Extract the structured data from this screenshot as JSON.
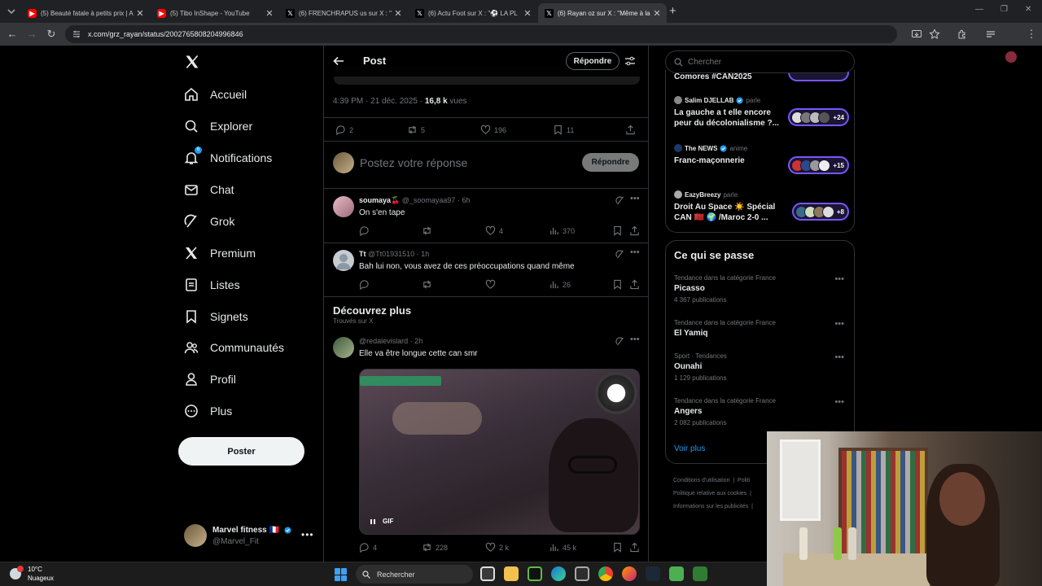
{
  "browser": {
    "tabs": [
      {
        "title": "(5) Beauté fatale à petits prix | A",
        "icon": "youtube-icon",
        "active": false
      },
      {
        "title": "(5) Tibo InShape - YouTube",
        "icon": "youtube-icon",
        "active": false
      },
      {
        "title": "(6) FRENCHRAPUS us sur X : \"",
        "icon": "x-icon",
        "active": false
      },
      {
        "title": "(6) Actu Foot sur X : \"⚽ LA PL",
        "icon": "x-icon",
        "active": false
      },
      {
        "title": "(6) Rayan oz sur X : \"Même à la",
        "icon": "x-icon",
        "active": true
      }
    ],
    "new_tab": "+",
    "url": "x.com/grz_rayan/status/2002765808204996846"
  },
  "nav": {
    "items": [
      {
        "label": "Accueil",
        "icon": "home-icon"
      },
      {
        "label": "Explorer",
        "icon": "search-icon"
      },
      {
        "label": "Notifications",
        "icon": "bell-icon",
        "badge": "6"
      },
      {
        "label": "Chat",
        "icon": "mail-icon"
      },
      {
        "label": "Grok",
        "icon": "grok-icon"
      },
      {
        "label": "Premium",
        "icon": "x-logo-icon"
      },
      {
        "label": "Listes",
        "icon": "list-icon"
      },
      {
        "label": "Signets",
        "icon": "bookmark-icon"
      },
      {
        "label": "Communautés",
        "icon": "communities-icon"
      },
      {
        "label": "Profil",
        "icon": "person-icon"
      },
      {
        "label": "Plus",
        "icon": "more-circle-icon"
      }
    ],
    "post_button": "Poster",
    "account": {
      "name": "Marvel fitness 🇫🇷",
      "handle": "@Marvel_Fit"
    }
  },
  "post": {
    "header_title": "Post",
    "reply_pill": "Répondre",
    "meta_time": "4:39 PM · 21 déc. 2025 · ",
    "meta_views": "16,8 k",
    "meta_views_label": " vues",
    "stats": {
      "replies": "2",
      "reposts": "5",
      "likes": "196",
      "bookmarks": "11"
    },
    "compose_placeholder": "Postez votre réponse",
    "compose_button": "Répondre"
  },
  "replies": [
    {
      "name": "soumaya🍒",
      "handle": "@_soomayaa97",
      "time": "· 6h",
      "text": "On s'en tape",
      "likes": "4",
      "views": "370"
    },
    {
      "name": "Tt",
      "handle": "@Tt01931510",
      "time": "· 1h",
      "text": "Bah lui non, vous avez de ces préoccupations quand même",
      "likes": "",
      "views": "26"
    }
  ],
  "discover": {
    "title": "Découvrez plus",
    "subtitle": "Trouvés sur X",
    "post": {
      "handle": "@redalevislard",
      "time": "· 2h",
      "text": "Elle va être longue cette can smr",
      "gif_label": "GIF",
      "replies": "4",
      "reposts": "228",
      "likes": "2 k",
      "views": "45 k"
    }
  },
  "search": {
    "placeholder": "Chercher"
  },
  "spaces": [
    {
      "title": "Comores #CAN2025"
    },
    {
      "host": "Salim DJELLAB",
      "verb": "parle",
      "title": "La gauche a t elle encore peur du décolonialisme ?...",
      "count": "+24"
    },
    {
      "host": "The NEWS",
      "verb": "anime",
      "title": "Franc-maçonnerie",
      "count": "+15"
    },
    {
      "host": "EazyBreezy",
      "verb": "parle",
      "title": "Droit Au Space ☀️ Spécial CAN 🇲🇦 🌍 /Maroc 2-0 ...",
      "count": "+8"
    }
  ],
  "trends": {
    "title": "Ce qui se passe",
    "items": [
      {
        "context": "Tendance dans la catégorie France",
        "name": "Picasso",
        "posts": "4 367 publications"
      },
      {
        "context": "Tendance dans la catégorie France",
        "name": "El Yamiq",
        "posts": ""
      },
      {
        "context": "Sport · Tendances",
        "name": "Ounahi",
        "posts": "1 129 publications"
      },
      {
        "context": "Tendance dans la catégorie France",
        "name": "Angers",
        "posts": "2 082 publications"
      }
    ],
    "more": "Voir plus"
  },
  "footer": {
    "links": [
      "Conditions d'utilisation",
      "Politique relative aux cookies",
      "Informations sur les publicités"
    ],
    "partial": "Politi"
  },
  "taskbar": {
    "weather_temp": "10°C",
    "weather_desc": "Nuageux",
    "search_label": "Rechercher"
  },
  "colors": {
    "accent": "#1d9bf0",
    "spaces_purple": "#7856ff",
    "bg": "#000000"
  }
}
